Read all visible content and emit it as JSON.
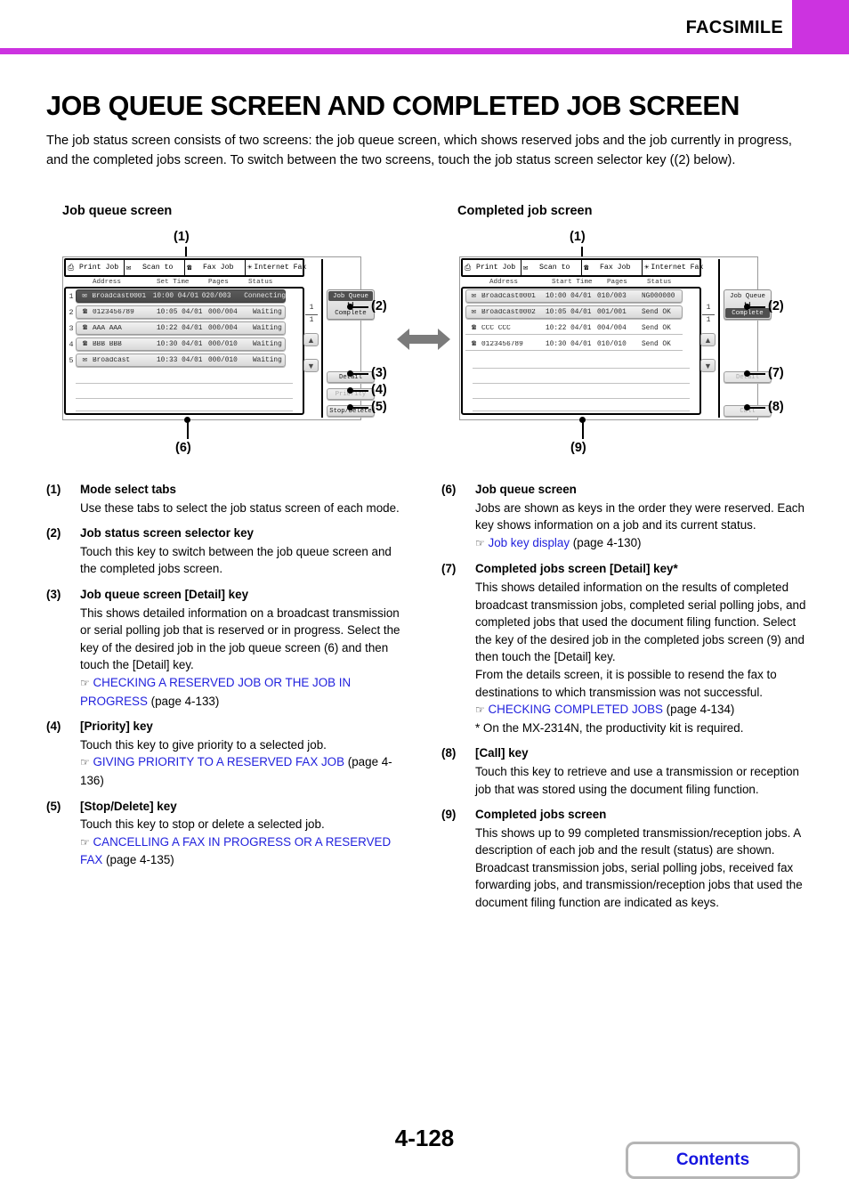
{
  "header": {
    "section_title": "FACSIMILE",
    "accent_color": "#cc33e0"
  },
  "page": {
    "title": "JOB QUEUE SCREEN AND COMPLETED JOB SCREEN",
    "intro": "The job status screen consists of two screens: the job queue screen, which shows reserved jobs and the job currently in progress, and the completed jobs screen. To switch between the two screens, touch the job status screen selector key ((2) below).",
    "number": "4-128"
  },
  "figures": {
    "left": {
      "caption": "Job queue screen",
      "callouts": {
        "c1": "(1)",
        "c2": "(2)",
        "c3": "(3)",
        "c4": "(4)",
        "c5": "(5)",
        "c6": "(6)"
      },
      "tabs": [
        {
          "label": "Print Job",
          "icon": "printer-icon",
          "glyph": "⎙"
        },
        {
          "label": "Scan to",
          "icon": "scanner-icon",
          "glyph": "✉"
        },
        {
          "label": "Fax Job",
          "icon": "fax-icon",
          "glyph": "☎"
        },
        {
          "label": "Internet Fax",
          "icon": "internet-fax-icon",
          "glyph": "⊕"
        }
      ],
      "columns": [
        "Address",
        "Set Time",
        "Pages",
        "Status"
      ],
      "rows": [
        {
          "num": "1",
          "icon": "broadcast-icon",
          "glyph": "⁂",
          "address": "Broadcast0001",
          "time": "10:00 04/01",
          "pages": "020/003",
          "status": "Connecting",
          "selected": true
        },
        {
          "num": "2",
          "icon": "phone-icon",
          "glyph": "☎",
          "address": "0123456789",
          "time": "10:05 04/01",
          "pages": "000/004",
          "status": "Waiting",
          "selected": false
        },
        {
          "num": "3",
          "icon": "phone-icon",
          "glyph": "☎",
          "address": "AAA AAA",
          "time": "10:22 04/01",
          "pages": "000/004",
          "status": "Waiting",
          "selected": false
        },
        {
          "num": "4",
          "icon": "phone-icon",
          "glyph": "☎",
          "address": "BBB BBB",
          "time": "10:30 04/01",
          "pages": "000/010",
          "status": "Waiting",
          "selected": false
        },
        {
          "num": "5",
          "icon": "broadcast-icon",
          "glyph": "⁂",
          "address": "Broadcast",
          "time": "10:33 04/01",
          "pages": "000/010",
          "status": "Waiting",
          "selected": false
        }
      ],
      "pager": {
        "current": "1",
        "total": "1"
      },
      "selector": {
        "top": "Job Queue",
        "bottom": "Complete",
        "active": "top"
      },
      "buttons": [
        {
          "label": "Detail",
          "disabled": false
        },
        {
          "label": "Priority",
          "disabled": true
        },
        {
          "label": "Stop/Delete",
          "disabled": false
        }
      ]
    },
    "right": {
      "caption": "Completed job screen",
      "callouts": {
        "c1": "(1)",
        "c2": "(2)",
        "c7": "(7)",
        "c8": "(8)",
        "c9": "(9)"
      },
      "tabs": [
        {
          "label": "Print Job",
          "icon": "printer-icon",
          "glyph": "⎙"
        },
        {
          "label": "Scan to",
          "icon": "scanner-icon",
          "glyph": "✉"
        },
        {
          "label": "Fax Job",
          "icon": "fax-icon",
          "glyph": "☎"
        },
        {
          "label": "Internet Fax",
          "icon": "internet-fax-icon",
          "glyph": "⊕"
        }
      ],
      "columns": [
        "Address",
        "Start Time",
        "Pages",
        "Status"
      ],
      "rows": [
        {
          "icon": "broadcast-icon",
          "glyph": "⁂",
          "address": "Broadcast0001",
          "time": "10:00 04/01",
          "pages": "010/003",
          "status": "NG000000",
          "key": true
        },
        {
          "icon": "broadcast-icon",
          "glyph": "⁂",
          "address": "Broadcast0002",
          "time": "10:05 04/01",
          "pages": "001/001",
          "status": "Send OK",
          "key": true
        },
        {
          "icon": "phone-icon",
          "glyph": "☎",
          "address": "CCC CCC",
          "time": "10:22 04/01",
          "pages": "004/004",
          "status": "Send OK",
          "key": false
        },
        {
          "icon": "phone-icon",
          "glyph": "☎",
          "address": "0123456789",
          "time": "10:30 04/01",
          "pages": "010/010",
          "status": "Send OK",
          "key": false
        }
      ],
      "pager": {
        "current": "1",
        "total": "1"
      },
      "selector": {
        "top": "Job Queue",
        "bottom": "Complete",
        "active": "bottom"
      },
      "buttons": [
        {
          "label": "Detail",
          "disabled": true
        },
        {
          "label": "Call",
          "disabled": true
        }
      ]
    },
    "swap_arrow": "swap-horizontal-icon"
  },
  "descriptions": {
    "left": [
      {
        "num": "(1)",
        "title": "Mode select tabs",
        "text": "Use these tabs to select the job status screen of each mode."
      },
      {
        "num": "(2)",
        "title": "Job status screen selector key",
        "text": "Touch this key to switch between the job queue screen and the completed jobs screen."
      },
      {
        "num": "(3)",
        "title": "Job queue screen [Detail] key",
        "text": "This shows detailed information on a broadcast transmission or serial polling job that is reserved or in progress. Select the key of the desired job in the job queue screen (6) and then touch the [Detail] key.",
        "link": "CHECKING A RESERVED JOB OR THE JOB IN PROGRESS",
        "link_page": "(page 4-133)"
      },
      {
        "num": "(4)",
        "title": "[Priority] key",
        "text": "Touch this key to give priority to a selected job.",
        "link": "GIVING PRIORITY TO A RESERVED FAX JOB",
        "link_page": "(page 4-136)"
      },
      {
        "num": "(5)",
        "title": "[Stop/Delete] key",
        "text": "Touch this key to stop or delete a selected job.",
        "link": "CANCELLING A FAX IN PROGRESS OR A RESERVED FAX",
        "link_page": "(page 4-135)"
      }
    ],
    "right": [
      {
        "num": "(6)",
        "title": "Job queue screen",
        "text": "Jobs are shown as keys in the order they were reserved. Each key shows information on a job and its current status.",
        "link": "Job key display",
        "link_page": "(page 4-130)"
      },
      {
        "num": "(7)",
        "title": "Completed jobs screen [Detail] key*",
        "text": "This shows detailed information on the results of completed broadcast transmission jobs, completed serial polling jobs, and completed jobs that used the document filing function. Select the key of the desired job in the completed jobs screen (9) and then touch the [Detail] key.",
        "text2": "From the details screen, it is possible to resend the fax to destinations to which transmission was not successful.",
        "link": "CHECKING COMPLETED JOBS",
        "link_page": "(page 4-134)",
        "footnote": "* On the MX-2314N, the productivity kit is required."
      },
      {
        "num": "(8)",
        "title": "[Call] key",
        "text": "Touch this key to retrieve and use a transmission or reception job that was stored using the document filing function."
      },
      {
        "num": "(9)",
        "title": "Completed jobs screen",
        "text": "This shows up to 99 completed transmission/reception jobs. A description of each job and the result (status) are shown.",
        "text2": "Broadcast transmission jobs, serial polling jobs, received fax forwarding jobs, and transmission/reception jobs that used the document filing function are indicated as keys."
      }
    ]
  },
  "footer": {
    "contents_label": "Contents"
  }
}
